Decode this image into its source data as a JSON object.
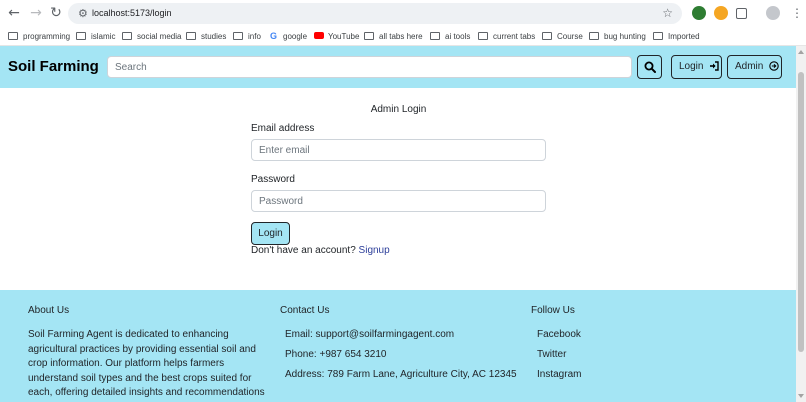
{
  "browser": {
    "url": "localhost:5173/login",
    "bookmarks": [
      {
        "label": "programming",
        "icon": "folder-icon"
      },
      {
        "label": "islamic",
        "icon": "folder-icon"
      },
      {
        "label": "social media",
        "icon": "folder-icon"
      },
      {
        "label": "studies",
        "icon": "folder-icon"
      },
      {
        "label": "info",
        "icon": "folder-icon"
      },
      {
        "label": "google",
        "icon": "google-icon"
      },
      {
        "label": "YouTube",
        "icon": "youtube-icon"
      },
      {
        "label": "all tabs here",
        "icon": "folder-icon"
      },
      {
        "label": "ai tools",
        "icon": "folder-icon"
      },
      {
        "label": "current tabs",
        "icon": "folder-icon"
      },
      {
        "label": "Course",
        "icon": "folder-icon"
      },
      {
        "label": "bug hunting",
        "icon": "folder-icon"
      },
      {
        "label": "Imported",
        "icon": "folder-icon"
      }
    ]
  },
  "navbar": {
    "brand": "Soil Farming",
    "search_placeholder": "Search",
    "login_label": "Login",
    "admin_label": "Admin",
    "accent_color": "#a4e5f4"
  },
  "form": {
    "title": "Admin Login",
    "email_label": "Email address",
    "email_placeholder": "Enter email",
    "password_label": "Password",
    "password_placeholder": "Password",
    "submit_label": "Login",
    "no_account_text": "Don't have an account?",
    "signup_link": "Signup"
  },
  "footer": {
    "about": {
      "heading": "About Us",
      "lines": [
        "Soil Farming Agent is dedicated to enhancing",
        "agricultural practices by providing essential soil and",
        "crop information. Our platform helps farmers",
        "understand soil types and the best crops suited for",
        "each, offering detailed insights and recommendations"
      ]
    },
    "contact": {
      "heading": "Contact Us",
      "email": "Email: support@soilfarmingagent.com",
      "phone": "Phone: +987 654 3210",
      "address": "Address: 789 Farm Lane, Agriculture City, AC 12345"
    },
    "follow": {
      "heading": "Follow Us",
      "links": [
        "Facebook",
        "Twitter",
        "Instagram"
      ]
    }
  }
}
